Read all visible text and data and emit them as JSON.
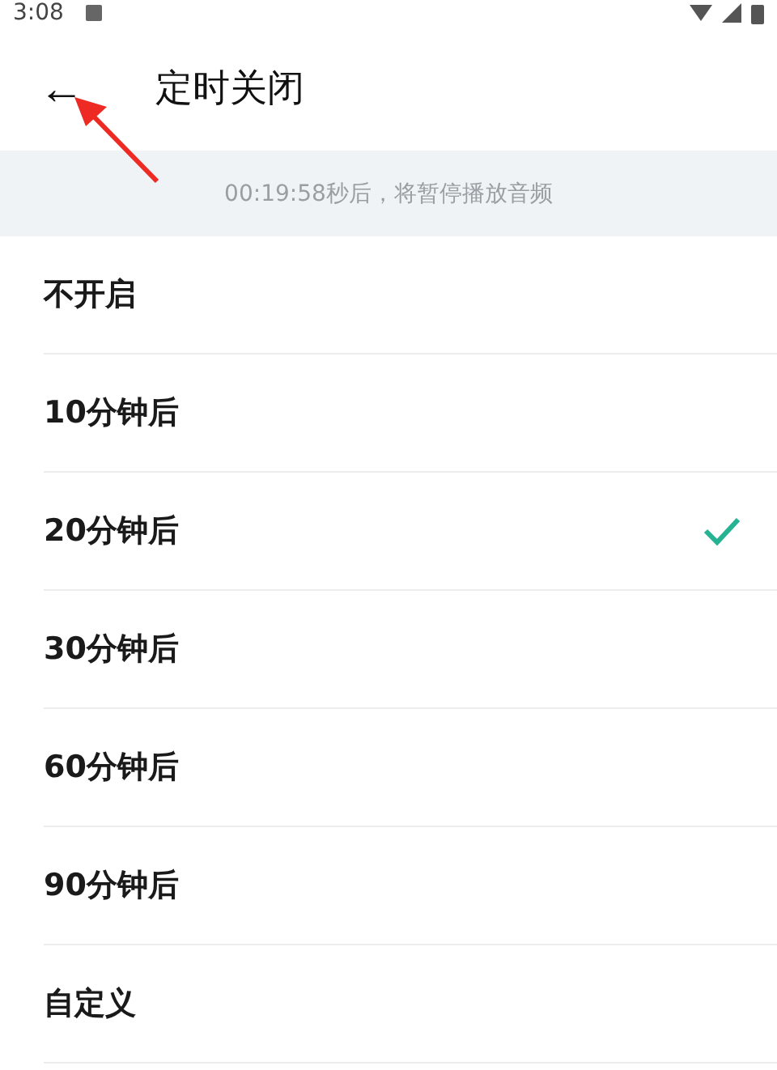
{
  "status_bar": {
    "time": "3:08"
  },
  "header": {
    "back": "←",
    "title": "定时关闭"
  },
  "banner": {
    "text": "00:19:58秒后，将暂停播放音频"
  },
  "options": [
    {
      "label": "不开启",
      "selected": false
    },
    {
      "label": "10分钟后",
      "selected": false
    },
    {
      "label": "20分钟后",
      "selected": true
    },
    {
      "label": "30分钟后",
      "selected": false
    },
    {
      "label": "60分钟后",
      "selected": false
    },
    {
      "label": "90分钟后",
      "selected": false
    },
    {
      "label": "自定义",
      "selected": false
    }
  ]
}
